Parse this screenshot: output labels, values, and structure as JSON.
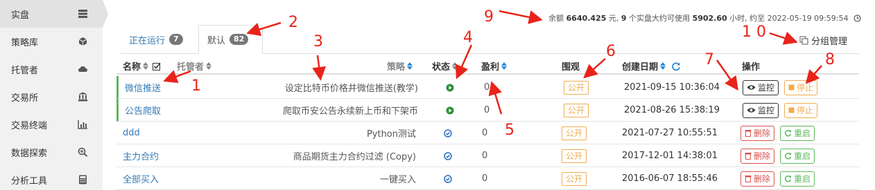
{
  "sidebar": {
    "items": [
      {
        "label": "实盘",
        "icon": "server-icon"
      },
      {
        "label": "策略库",
        "icon": "cube-icon"
      },
      {
        "label": "托管者",
        "icon": "cloud-icon"
      },
      {
        "label": "交易所",
        "icon": "bank-icon"
      },
      {
        "label": "交易终端",
        "icon": "bar-chart-icon"
      },
      {
        "label": "数据探索",
        "icon": "search-plus-icon"
      },
      {
        "label": "分析工具",
        "icon": "calculator-icon"
      }
    ]
  },
  "summary": {
    "prefix": "余额",
    "balance": "6640.425",
    "mid1": "元, ",
    "count": "9",
    "mid2": "个实盘大约可使用",
    "hours": "5902.60",
    "mid3": "小时, 约至 2022-05-19 09:59:54"
  },
  "group_manage_label": "分组管理",
  "tabs": [
    {
      "label": "正在运行",
      "count": "7"
    },
    {
      "label": "默认",
      "count": "82"
    }
  ],
  "table": {
    "headers": {
      "name": "名称",
      "host": "托管者",
      "strategy": "策略",
      "status": "状态",
      "profit": "盈利",
      "watch": "围观",
      "created": "创建日期",
      "actions": "操作"
    },
    "rows": [
      {
        "name": "微信推送",
        "strategy": "设定比特币价格并微信推送(教学)",
        "status": "running",
        "profit": "0",
        "watch": "公开",
        "created": "2021-09-15 10:36:04",
        "btn1": "监控",
        "btn2": "停止"
      },
      {
        "name": "公告爬取",
        "strategy": "爬取币安公告永续新上币和下架币",
        "status": "running",
        "profit": "0",
        "watch": "公开",
        "created": "2021-08-26 15:38:19",
        "btn1": "监控",
        "btn2": "停止"
      },
      {
        "name": "ddd",
        "strategy": "Python测试",
        "status": "stopped",
        "profit": "0",
        "watch": "公开",
        "created": "2021-07-27 10:55:51",
        "btn1": "删除",
        "btn2": "重启"
      },
      {
        "name": "主力合约",
        "strategy": "商品期货主力合约过滤 (Copy)",
        "status": "stopped",
        "profit": "0",
        "watch": "公开",
        "created": "2017-12-01 14:38:01",
        "btn1": "删除",
        "btn2": "重启"
      },
      {
        "name": "全部买入",
        "strategy": "一键买入",
        "status": "stopped",
        "profit": "0",
        "watch": "公开",
        "created": "2016-06-07 18:55:46",
        "btn1": "删除",
        "btn2": "重启"
      }
    ]
  },
  "annotations": [
    "1",
    "2",
    "3",
    "4",
    "5",
    "6",
    "7",
    "8",
    "9",
    "1 0"
  ],
  "colors": {
    "link": "#337ab7",
    "running": "#5cb85c",
    "public": "#f0ad4e",
    "danger": "#d9534f",
    "annotation": "#e8231a"
  }
}
